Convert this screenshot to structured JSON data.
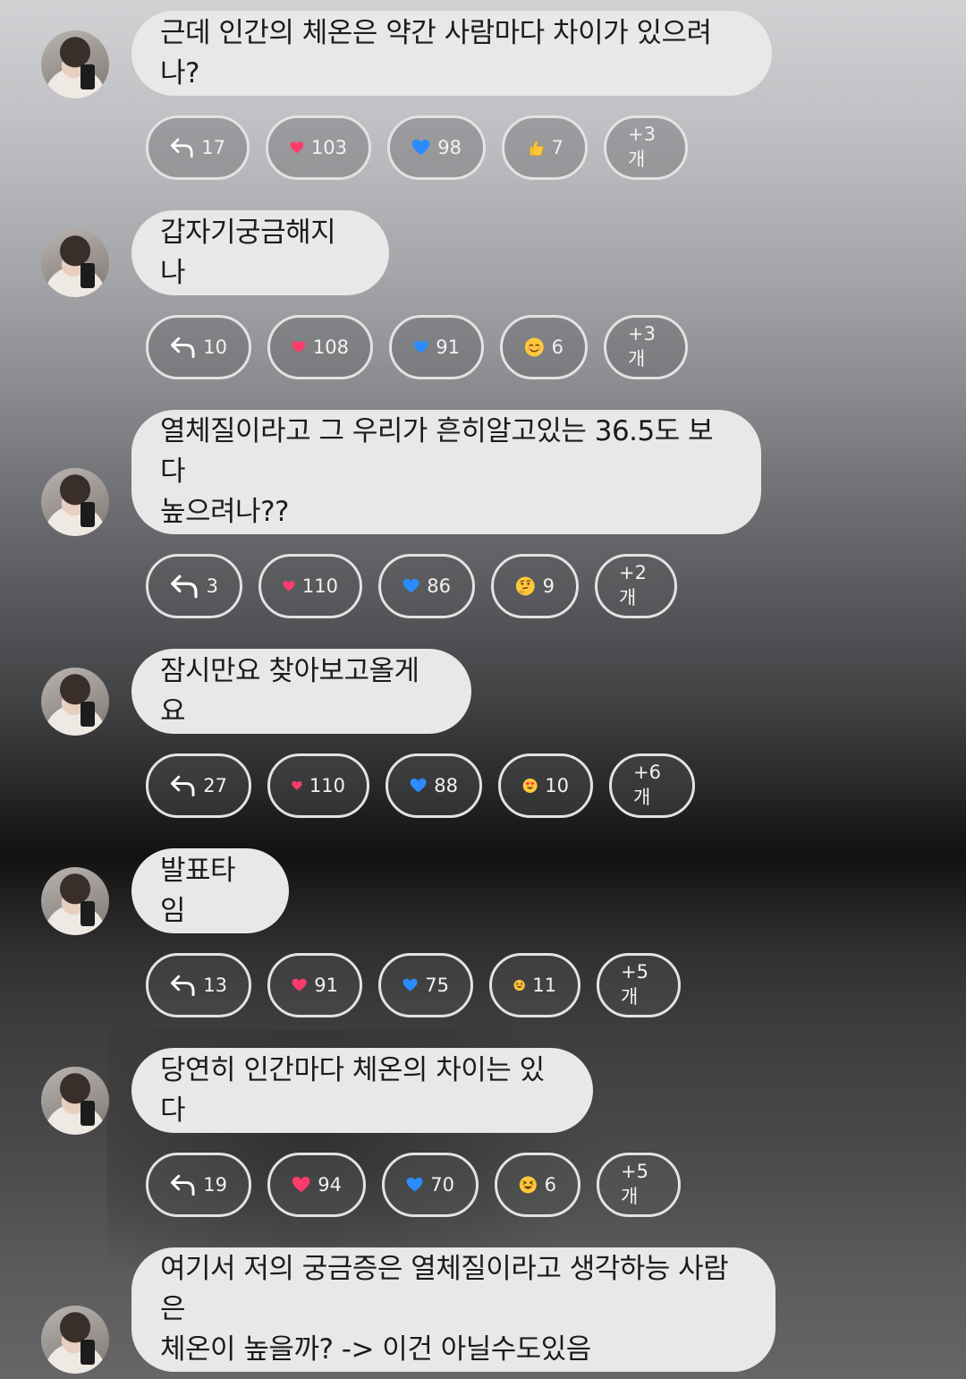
{
  "messages": [
    {
      "text": "근데 인간의 체온은 약간 사람마다 차이가 있으려나?",
      "reactions": {
        "reply": "17",
        "heart": "103",
        "blue_heart": "98",
        "emoji_name": "thumbs-up",
        "emoji_count": "7",
        "more": "+3개"
      }
    },
    {
      "text": "갑자기궁금해지나",
      "reactions": {
        "reply": "10",
        "heart": "108",
        "blue_heart": "91",
        "emoji_name": "smiling-face",
        "emoji_count": "6",
        "more": "+3개"
      }
    },
    {
      "text": "열체질이라고 그 우리가 흔히알고있는 36.5도 보다\n높으려나??",
      "reactions": {
        "reply": "3",
        "heart": "110",
        "blue_heart": "86",
        "emoji_name": "thinking-face",
        "emoji_count": "9",
        "more": "+2개"
      }
    },
    {
      "text": "잠시만요 찾아보고올게요",
      "reactions": {
        "reply": "27",
        "heart": "110",
        "blue_heart": "88",
        "emoji_name": "heart-eyes-face",
        "emoji_count": "10",
        "more": "+6개"
      }
    },
    {
      "text": "발표타임",
      "reactions": {
        "reply": "13",
        "heart": "91",
        "blue_heart": "75",
        "emoji_name": "squinting-laugh-face",
        "emoji_count": "11",
        "more": "+5개"
      }
    },
    {
      "text": "당연히 인간마다 체온의 차이는 있다",
      "reactions": {
        "reply": "19",
        "heart": "94",
        "blue_heart": "70",
        "emoji_name": "squinting-laugh-face",
        "emoji_count": "6",
        "more": "+5개"
      }
    },
    {
      "text": "여기서 저의 궁금증은 열체질이라고 생각하능 사람은\n체온이 높을까? -> 이건 아닐수도있음",
      "reactions": null
    }
  ],
  "colors": {
    "bubble": "#e8e8e8",
    "heart": "#ff3b6b",
    "blue_heart": "#2a8cff",
    "emoji_yellow": "#ffc83a"
  }
}
